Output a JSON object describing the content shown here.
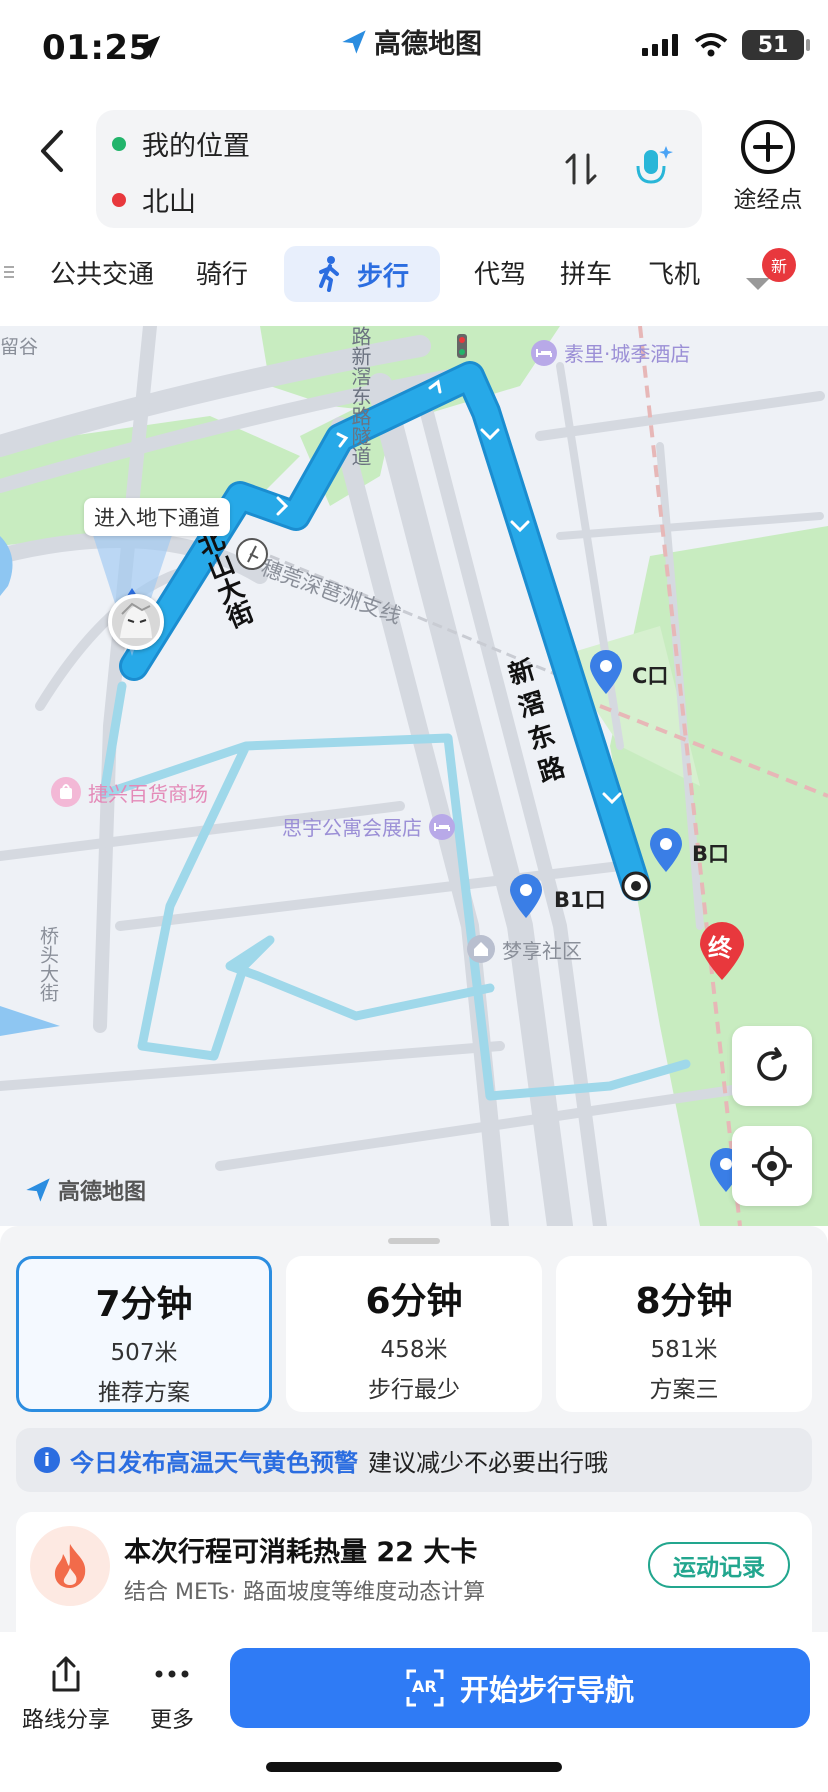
{
  "status_bar": {
    "time": "01:25",
    "brand": "高德地图",
    "battery": "51"
  },
  "route": {
    "origin": "我的位置",
    "destination": "北山",
    "waypoint_label": "途经点",
    "origin_color": "#22b46b",
    "destination_color": "#e8383d"
  },
  "modes": {
    "items": [
      "公共交通",
      "骑行",
      "步行",
      "代驾",
      "拼车",
      "飞机"
    ],
    "active": "步行",
    "new_badge": "新"
  },
  "map": {
    "tooltip": "进入地下通道",
    "pois": {
      "hotel": "素里·城季酒店",
      "mall": "捷兴百货商场",
      "apartment": "思宇公寓会展店",
      "community": "梦享社区"
    },
    "road_labels": {
      "beishan_ave": "北山大街",
      "xinjiao_east": "新滘东路",
      "tunnel": "路新滘东路隧道",
      "railway": "穗莞深琶洲支线",
      "qiaotou": "桥头大街",
      "left_edge": "留谷"
    },
    "exits": {
      "c": "C口",
      "b": "B口",
      "b1": "B1口"
    },
    "end_marker": "终",
    "logo": "高德地图",
    "route_color": "#27a9e8",
    "alt_route_color": "#9fd8ea"
  },
  "plans": [
    {
      "duration": "7分钟",
      "distance": "507米",
      "label": "推荐方案"
    },
    {
      "duration": "6分钟",
      "distance": "458米",
      "label": "步行最少"
    },
    {
      "duration": "8分钟",
      "distance": "581米",
      "label": "方案三"
    }
  ],
  "notice": {
    "highlight": "今日发布高温天气黄色预警",
    "text": "建议减少不必要出行哦"
  },
  "calorie": {
    "title": "本次行程可消耗热量 22 大卡",
    "subtitle": "结合 METs· 路面坡度等维度动态计算",
    "record_button": "运动记录"
  },
  "bottom": {
    "share_label": "路线分享",
    "more_label": "更多",
    "start_label": "开始步行导航",
    "ar_icon_text": "AR"
  }
}
